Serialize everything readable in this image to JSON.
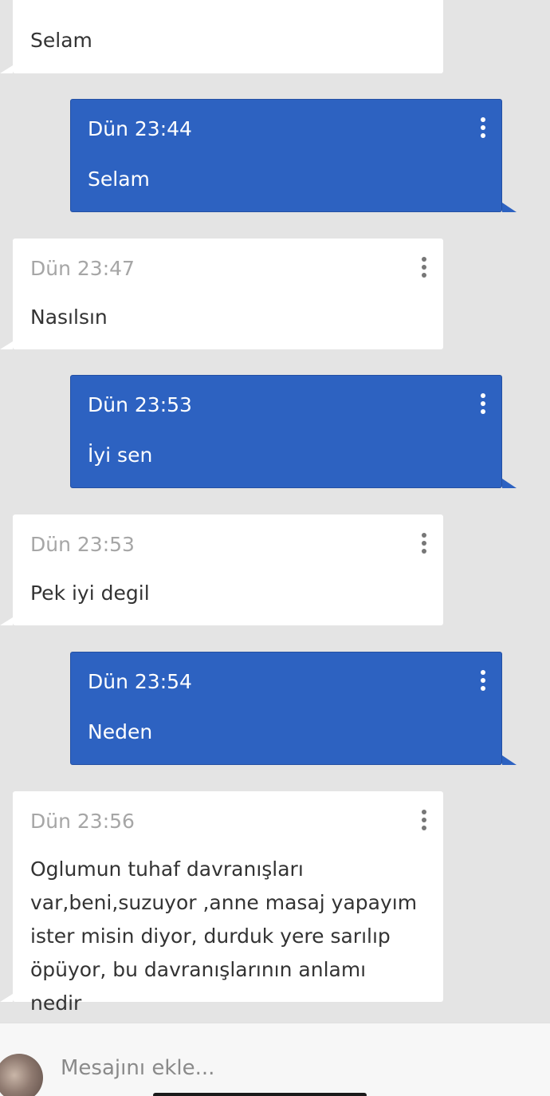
{
  "messages": [
    {
      "direction": "incoming",
      "time": "",
      "text": "Selam"
    },
    {
      "direction": "outgoing",
      "time": "Dün 23:44",
      "text": "Selam"
    },
    {
      "direction": "incoming",
      "time": "Dün 23:47",
      "text": "Nasılsın"
    },
    {
      "direction": "outgoing",
      "time": "Dün 23:53",
      "text": "İyi sen"
    },
    {
      "direction": "incoming",
      "time": "Dün 23:53",
      "text": "Pek iyi degil"
    },
    {
      "direction": "outgoing",
      "time": "Dün 23:54",
      "text": "Neden"
    },
    {
      "direction": "incoming",
      "time": "Dün 23:56",
      "text_lines": [
        "Oglumun tuhaf davranışları",
        "var,beni,suzuyor ,anne masaj yapayım",
        "ister misin diyor, durduk yere sarılıp",
        "öpüyor, bu davranışlarının anlamı nedir"
      ]
    }
  ],
  "composer": {
    "placeholder": "Mesajını ekle..."
  },
  "colors": {
    "background": "#e4e4e4",
    "incoming_bubble": "#ffffff",
    "outgoing_bubble": "#2d62c1"
  },
  "icons": {
    "message_menu": "more-vertical-icon",
    "user_avatar": "avatar"
  }
}
